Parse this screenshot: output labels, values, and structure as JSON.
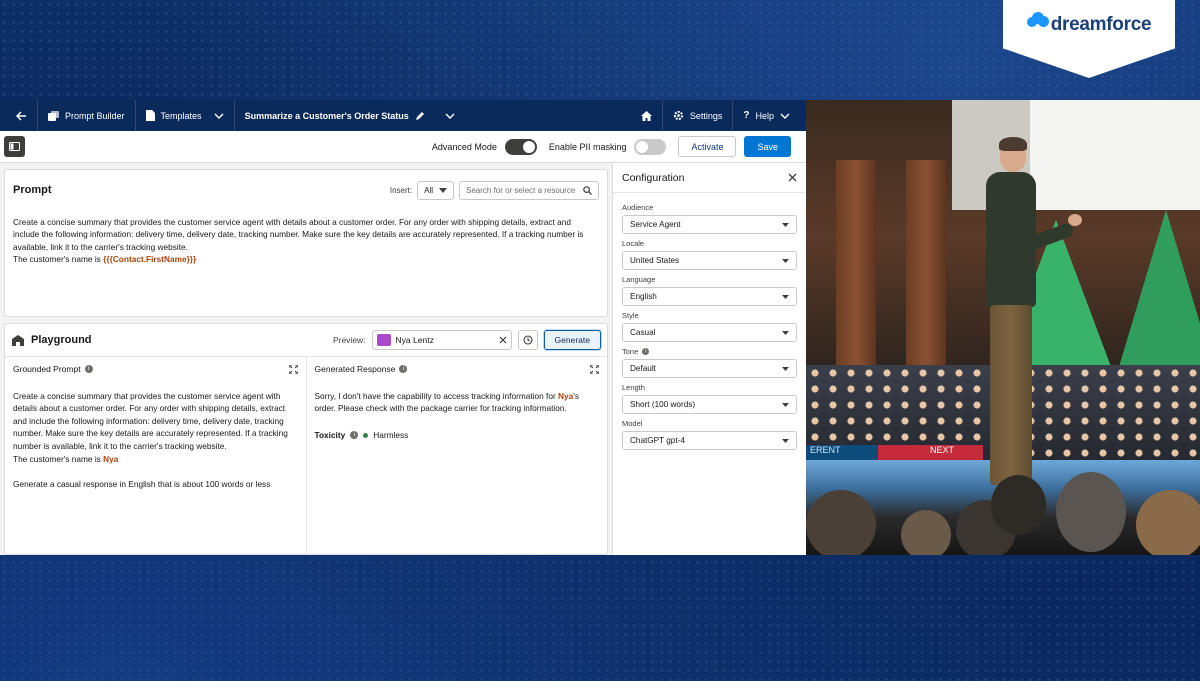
{
  "brand": {
    "event": "dreamforce"
  },
  "topbar": {
    "app_name": "Prompt Builder",
    "nav_templates": "Templates",
    "template_title": "Summarize a Customer's Order Status",
    "settings": "Settings",
    "help": "Help"
  },
  "toolbar": {
    "advanced_mode_label": "Advanced Mode",
    "advanced_mode_on": true,
    "pii_label": "Enable PII masking",
    "pii_on": false,
    "activate": "Activate",
    "save": "Save"
  },
  "prompt": {
    "title": "Prompt",
    "insert_label": "Insert:",
    "insert_value": "All",
    "search_placeholder": "Search for or select a resource",
    "body_line1": "Create a concise summary that provides the customer service agent with details about a customer order. For any order with shipping details, extract and include the following information: delivery time, delivery date, tracking number. Make sure the key details are accurately represented. If a tracking number is available, link it to the carrier's tracking website.",
    "body_line2_prefix": "The customer's name is ",
    "body_merge_field": "{{{Contact.FirstName}}}"
  },
  "playground": {
    "title": "Playground",
    "preview_label": "Preview:",
    "preview_value": "Nya Lentz",
    "generate": "Generate",
    "grounded_title": "Grounded Prompt",
    "grounded_text": "Create a concise summary that provides the customer service agent with details about a customer order. For any order with shipping details, extract and include the following information: delivery time, delivery date, tracking number. Make sure the key details are accurately represented. If a tracking number is available, link it to the carrier's tracking website.",
    "grounded_name_prefix": "The customer's name is ",
    "grounded_name": "Nya",
    "grounded_extra": "Generate a casual response in English that is about 100 words or less",
    "response_title": "Generated Response",
    "response_prefix": "Sorry, I don't have the capability to access tracking information for ",
    "response_name": "Nya",
    "response_suffix": "'s order. Please check with the package carrier for tracking information.",
    "toxicity_label": "Toxicity",
    "toxicity_value": "Harmless"
  },
  "config": {
    "title": "Configuration",
    "fields": [
      {
        "label": "Audience",
        "value": "Service Agent"
      },
      {
        "label": "Locale",
        "value": "United States"
      },
      {
        "label": "Language",
        "value": "English"
      },
      {
        "label": "Style",
        "value": "Casual"
      },
      {
        "label": "Tone",
        "value": "Default"
      },
      {
        "label": "Length",
        "value": "Short (100 words)"
      },
      {
        "label": "Model",
        "value": "ChatGPT gpt-4"
      }
    ]
  },
  "video": {
    "led_left": "ERENT",
    "led_right": "NEXT"
  },
  "colors": {
    "navy": "#0b2a5c",
    "brand_blue": "#0176d3",
    "merge_orange": "#a8430a",
    "harmless_green": "#2e844a"
  }
}
